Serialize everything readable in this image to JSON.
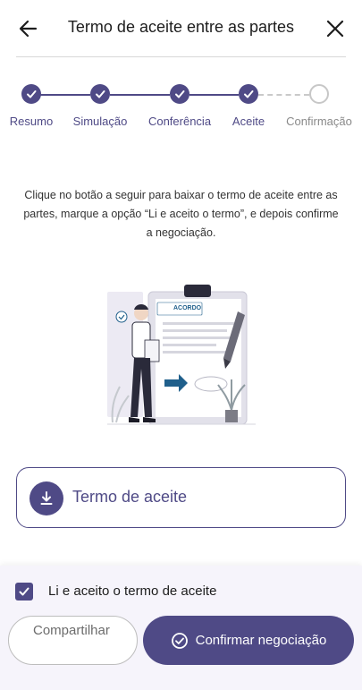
{
  "header": {
    "title": "Termo de aceite entre as partes",
    "back_icon": "arrow-left-icon",
    "close_icon": "close-icon"
  },
  "stepper": {
    "steps": [
      {
        "label": "Resumo",
        "status": "done"
      },
      {
        "label": "Simulação",
        "status": "done"
      },
      {
        "label": "Conferência",
        "status": "done"
      },
      {
        "label": "Aceite",
        "status": "done"
      },
      {
        "label": "Confirmação",
        "status": "pending"
      }
    ]
  },
  "instructions": "Clique no botão a seguir para baixar o termo de aceite entre as partes, marque a opção “Li e aceito o termo”, e depois confirme a negociação.",
  "illustration": {
    "document_title": "ACORDO"
  },
  "download": {
    "label": "Termo de aceite",
    "icon": "download-icon"
  },
  "footer": {
    "checkbox_label": "Li e aceito o termo de aceite",
    "checkbox_checked": true,
    "share_label": "Compartilhar",
    "confirm_label": "Confirmar negociação",
    "confirm_icon": "check-circle-icon"
  },
  "colors": {
    "primary": "#4f4a86",
    "pending": "#c7c7c7",
    "accent_blue": "#1f5f8b"
  }
}
